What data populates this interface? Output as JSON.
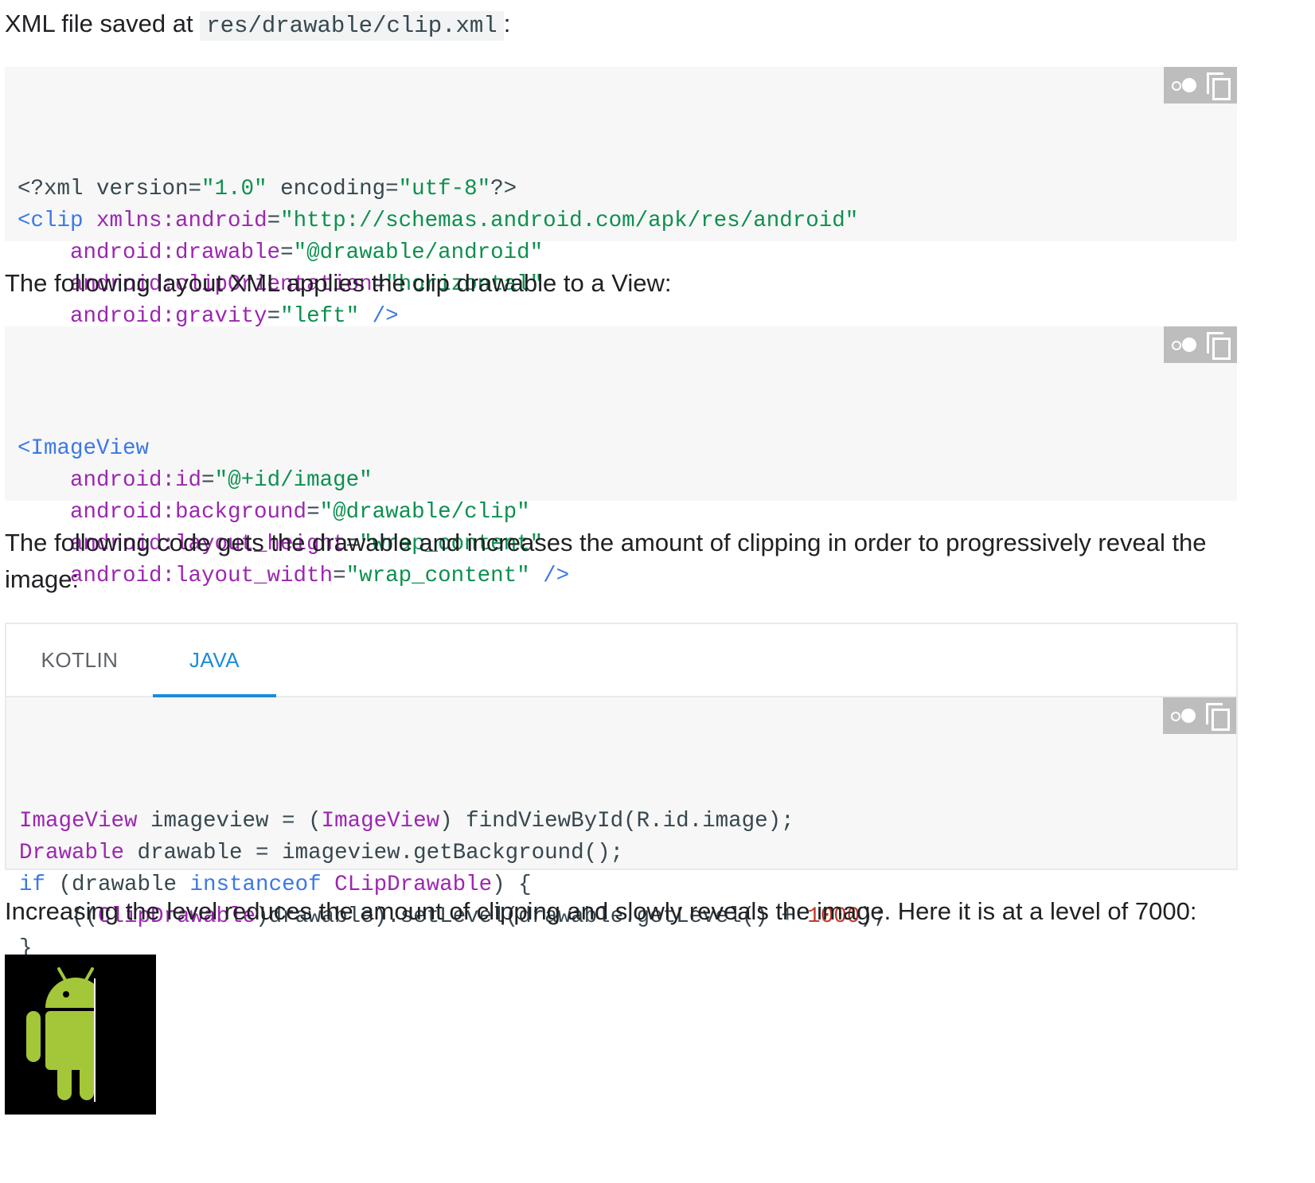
{
  "intro": {
    "prefix": "XML file saved at ",
    "path": "res/drawable/clip.xml",
    "suffix": ":"
  },
  "clip_xml_lines": [
    [
      {
        "t": "<?xml version=\"1.0\" encoding=\"utf-8\"?>",
        "c": "mixed1"
      }
    ],
    [],
    [],
    [],
    []
  ],
  "code_blocks": {
    "clip_xml": [
      [
        [
          "<?xml version=",
          "plain"
        ],
        [
          "\"1.0\"",
          "str"
        ],
        [
          " encoding=",
          "plain"
        ],
        [
          "\"utf-8\"",
          "str"
        ],
        [
          "?>",
          "plain"
        ]
      ],
      [
        [
          "<clip ",
          "tag"
        ],
        [
          "xmlns:android",
          "attr"
        ],
        [
          "=",
          "plain"
        ],
        [
          "\"http://schemas.android.com/apk/res/android\"",
          "str"
        ]
      ],
      [
        [
          "    android:drawable",
          "attr"
        ],
        [
          "=",
          "plain"
        ],
        [
          "\"@drawable/android\"",
          "str"
        ]
      ],
      [
        [
          "    android:clipOrientation",
          "attr"
        ],
        [
          "=",
          "plain"
        ],
        [
          "\"horizontal\"",
          "str"
        ]
      ],
      [
        [
          "    android:gravity",
          "attr"
        ],
        [
          "=",
          "plain"
        ],
        [
          "\"left\"",
          "str"
        ],
        [
          " />",
          "tag"
        ]
      ]
    ],
    "layout_xml": [
      [
        [
          "<ImageView",
          "tag"
        ]
      ],
      [
        [
          "    android:id",
          "attr"
        ],
        [
          "=",
          "plain"
        ],
        [
          "\"@+id/image\"",
          "str"
        ]
      ],
      [
        [
          "    android:background",
          "attr"
        ],
        [
          "=",
          "plain"
        ],
        [
          "\"@drawable/clip\"",
          "str"
        ]
      ],
      [
        [
          "    android:layout_height",
          "attr"
        ],
        [
          "=",
          "plain"
        ],
        [
          "\"wrap_content\"",
          "str"
        ]
      ],
      [
        [
          "    android:layout_width",
          "attr"
        ],
        [
          "=",
          "plain"
        ],
        [
          "\"wrap_content\"",
          "str"
        ],
        [
          " />",
          "tag"
        ]
      ]
    ],
    "java": [
      [
        [
          "ImageView",
          "type"
        ],
        [
          " imageview = (",
          "plain"
        ],
        [
          "ImageView",
          "type"
        ],
        [
          ") findViewById(R.id.image);",
          "plain"
        ]
      ],
      [
        [
          "Drawable",
          "type"
        ],
        [
          " drawable = imageview.getBackground();",
          "plain"
        ]
      ],
      [
        [
          "if",
          "kw"
        ],
        [
          " (drawable ",
          "plain"
        ],
        [
          "instanceof",
          "kw"
        ],
        [
          " ",
          "plain"
        ],
        [
          "CLipDrawable",
          "type"
        ],
        [
          ") {",
          "plain"
        ]
      ],
      [
        [
          "    ((",
          "plain"
        ],
        [
          "ClipDrawable",
          "type"
        ],
        [
          ")drawable).setLevel(drawable.getLevel() + ",
          "plain"
        ],
        [
          "1000",
          "num"
        ],
        [
          ");",
          "plain"
        ]
      ],
      [
        [
          "}",
          "plain"
        ]
      ]
    ]
  },
  "text": {
    "layout_intro": "The following layout XML applies the clip drawable to a View:",
    "code_intro_1": "The following code gets the drawable and increases the amount of clipping in order to progressively reveal the",
    "code_intro_2": "image:",
    "level_note": "Increasing the level reduces the amount of clipping and slowly reveals the image. Here it is at a level of 7000:"
  },
  "tabs": [
    {
      "label": "KOTLIN",
      "active": false
    },
    {
      "label": "JAVA",
      "active": true
    }
  ],
  "toolbar_icons": [
    "toggle-dark-mode-icon",
    "copy-icon"
  ],
  "colors": {
    "android_green": "#a4c639",
    "tab_active": "#1a8cd8",
    "code_bg": "#f7f7f7"
  },
  "demo": {
    "image_name": "android-robot-clipped",
    "level": 7000
  }
}
